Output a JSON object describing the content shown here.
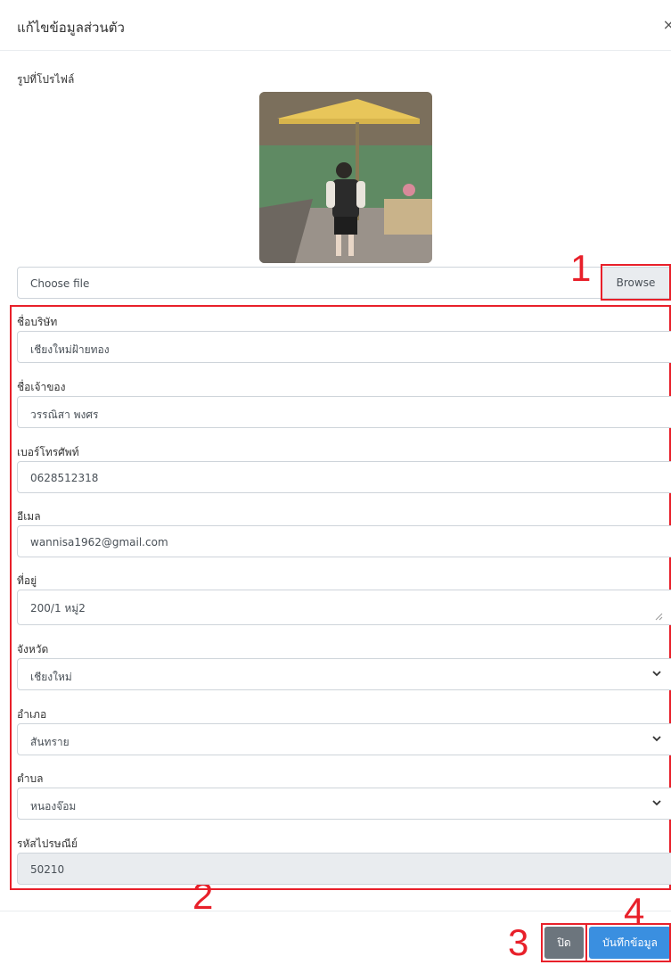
{
  "modal": {
    "title": "แก้ไขข้อมูลส่วนตัว",
    "close_glyph": "×"
  },
  "profile": {
    "label": "รูปที่โปรไฟล์"
  },
  "file_input": {
    "placeholder": "Choose file",
    "browse_label": "Browse"
  },
  "fields": [
    {
      "label": "ชื่อบริษัท",
      "value": "เชียงใหม่ฝ้ายทอง",
      "type": "text"
    },
    {
      "label": "ชื่อเจ้าของ",
      "value": "วรรณิสา พงศร",
      "type": "text"
    },
    {
      "label": "เบอร์โทรศัพท์",
      "value": "0628512318",
      "type": "text"
    },
    {
      "label": "อีเมล",
      "value": "wannisa1962@gmail.com",
      "type": "text"
    },
    {
      "label": "ที่อยู่",
      "value": "200/1 หมู่2",
      "type": "textarea"
    },
    {
      "label": "จังหวัด",
      "value": "เชียงใหม่",
      "type": "select"
    },
    {
      "label": "อำเภอ",
      "value": "สันทราย",
      "type": "select"
    },
    {
      "label": "ตำบล",
      "value": "หนองจ๊อม",
      "type": "select"
    },
    {
      "label": "รหัสไปรษณีย์",
      "value": "50210",
      "type": "readonly"
    }
  ],
  "buttons": {
    "close_label": "ปิด",
    "save_label": "บันทึกข้อมูล"
  },
  "annotations": {
    "n1": "1",
    "n2": "2",
    "n3": "3",
    "n4": "4"
  },
  "colors": {
    "annotation": "#e8202a",
    "save": "#3a8fe0",
    "close": "#6c757d"
  }
}
